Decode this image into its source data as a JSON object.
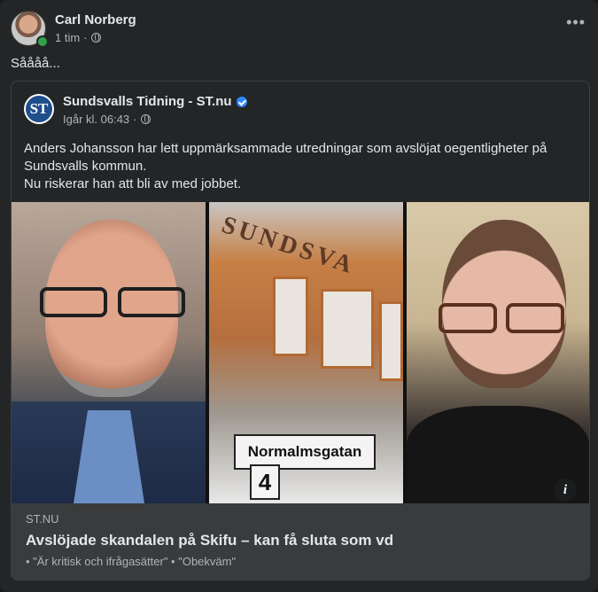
{
  "post": {
    "author": "Carl Norberg",
    "time": "1 tim",
    "separator": "·",
    "text": "Såååå...",
    "more_icon": "more-horizontal-icon"
  },
  "shared": {
    "page_name": "Sundsvalls Tidning - ST.nu",
    "logo_text": "ST",
    "time": "Igår kl. 06:43",
    "separator": "·",
    "body_line1": "Anders Johansson har lett uppmärksammade utredningar som avslöjat oegentligheter på",
    "body_line2": "Sundsvalls kommun.",
    "body_line3": "Nu riskerar han att bli av med jobbet.",
    "image": {
      "building_sign": "SUNDSVA",
      "street_sign": "Normalmsgatan",
      "house_number": "4"
    },
    "info_label": "i",
    "link_domain": "ST.NU",
    "link_title": "Avslöjade skandalen på Skifu – kan få sluta som vd",
    "link_subtitle": "• \"Är kritisk och ifrågasätter\" • \"Obekväm\""
  },
  "colors": {
    "background": "#242526",
    "text": "#e4e6eb",
    "secondary_text": "#b0b3b8",
    "verified": "#2d88ff",
    "online": "#31a24c"
  }
}
